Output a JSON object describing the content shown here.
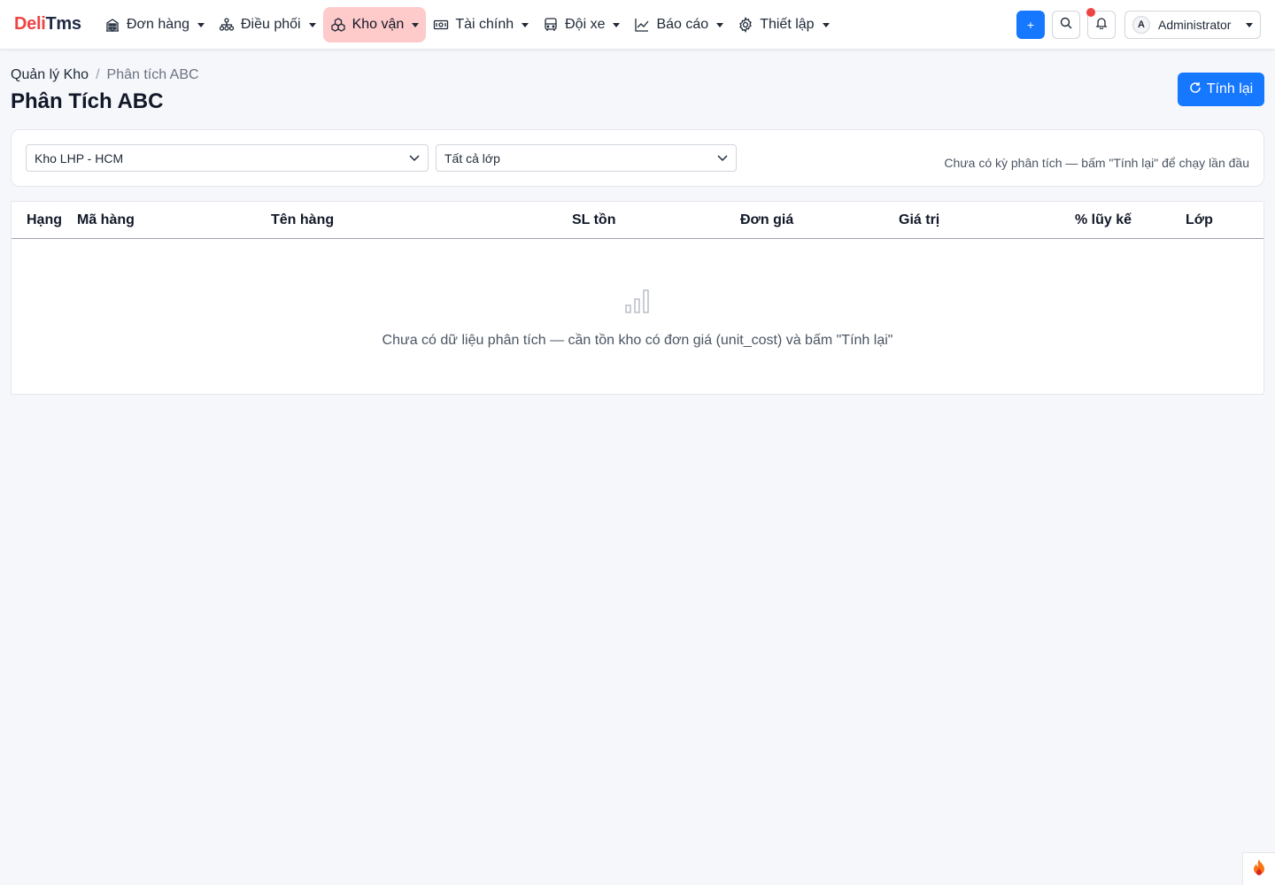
{
  "brand": {
    "part1": "Deli",
    "part2": "Tms"
  },
  "menu": [
    {
      "label": "Đơn hàng",
      "icon": "building-icon"
    },
    {
      "label": "Điều phối",
      "icon": "hierarchy-icon"
    },
    {
      "label": "Kho vận",
      "icon": "boxes-icon",
      "active": true
    },
    {
      "label": "Tài chính",
      "icon": "cash-icon"
    },
    {
      "label": "Đội xe",
      "icon": "bus-icon"
    },
    {
      "label": "Báo cáo",
      "icon": "chart-line-icon"
    },
    {
      "label": "Thiết lập",
      "icon": "gear-icon"
    }
  ],
  "nav_right": {
    "plus": "+",
    "avatar_initial": "A",
    "user": "Administrator"
  },
  "breadcrumb": {
    "parent": "Quản lý Kho",
    "separator": "/",
    "current": "Phân tích ABC"
  },
  "page_title": "Phân Tích ABC",
  "recalc_label": "Tính lại",
  "filters": {
    "warehouse": "Kho LHP - HCM",
    "class": "Tất cả lớp",
    "note": "Chưa có kỳ phân tích — bấm \"Tính lại\" để chạy lần đầu"
  },
  "table": {
    "columns": [
      "Hạng",
      "Mã hàng",
      "Tên hàng",
      "SL tồn",
      "Đơn giá",
      "Giá trị",
      "% lũy kế",
      "Lớp"
    ],
    "empty_text": "Chưa có dữ liệu phân tích — cần tồn kho có đơn giá (unit_cost) và bấm \"Tính lại\""
  },
  "colors": {
    "primary": "#1677ff",
    "brand_red": "#ef4444",
    "active_menu": "#fecaca"
  }
}
